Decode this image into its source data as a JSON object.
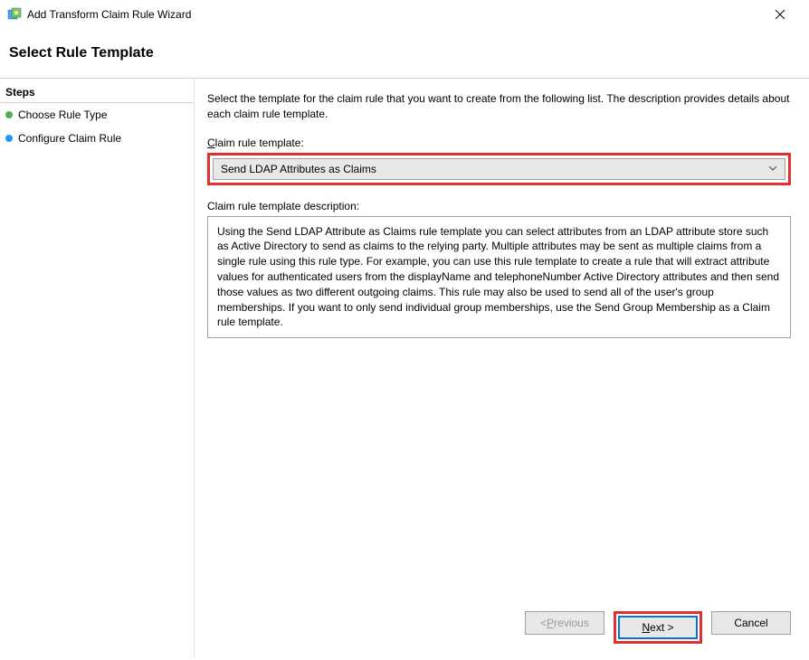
{
  "window": {
    "title": "Add Transform Claim Rule Wizard"
  },
  "header": {
    "title": "Select Rule Template"
  },
  "sidebar": {
    "steps_label": "Steps",
    "items": [
      {
        "label": "Choose Rule Type",
        "bullet": "green"
      },
      {
        "label": "Configure Claim Rule",
        "bullet": "blue"
      }
    ]
  },
  "content": {
    "intro": "Select the template for the claim rule that you want to create from the following list. The description provides details about each claim rule template.",
    "template_label_pre": "",
    "template_label_under": "C",
    "template_label_post": "laim rule template:",
    "template_selected": "Send LDAP Attributes as Claims",
    "desc_label": "Claim rule template description:",
    "desc_text": "Using the Send LDAP Attribute as Claims rule template you can select attributes from an LDAP attribute store such as Active Directory to send as claims to the relying party. Multiple attributes may be sent as multiple claims from a single rule using this rule type. For example, you can use this rule template to create a rule that will extract attribute values for authenticated users from the displayName and telephoneNumber Active Directory attributes and then send those values as two different outgoing claims. This rule may also be used to send all of the user's group memberships. If you want to only send individual group memberships, use the Send Group Membership as a Claim rule template."
  },
  "buttons": {
    "previous_pre": "< ",
    "previous_under": "P",
    "previous_post": "revious",
    "next_under": "N",
    "next_post": "ext >",
    "cancel": "Cancel"
  }
}
